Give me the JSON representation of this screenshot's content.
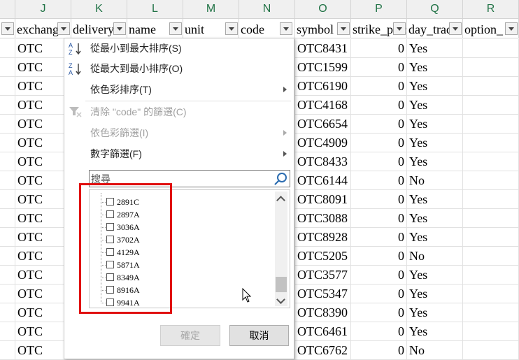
{
  "columns": [
    {
      "letter": "J",
      "header": "exchange"
    },
    {
      "letter": "K",
      "header": "delivery"
    },
    {
      "letter": "L",
      "header": "name"
    },
    {
      "letter": "M",
      "header": "unit"
    },
    {
      "letter": "N",
      "header": "code"
    },
    {
      "letter": "O",
      "header": "symbol"
    },
    {
      "letter": "P",
      "header": "strike_price"
    },
    {
      "letter": "Q",
      "header": "day_trade"
    },
    {
      "letter": "R",
      "header": "option_"
    }
  ],
  "rows": [
    {
      "exchange": "OTC",
      "symbol": "OTC8431",
      "strike": "0",
      "day_trade": "Yes"
    },
    {
      "exchange": "OTC",
      "symbol": "OTC1599",
      "strike": "0",
      "day_trade": "Yes"
    },
    {
      "exchange": "OTC",
      "symbol": "OTC6190",
      "strike": "0",
      "day_trade": "Yes"
    },
    {
      "exchange": "OTC",
      "symbol": "OTC4168",
      "strike": "0",
      "day_trade": "Yes"
    },
    {
      "exchange": "OTC",
      "symbol": "OTC6654",
      "strike": "0",
      "day_trade": "Yes"
    },
    {
      "exchange": "OTC",
      "symbol": "OTC4909",
      "strike": "0",
      "day_trade": "Yes"
    },
    {
      "exchange": "OTC",
      "symbol": "OTC8433",
      "strike": "0",
      "day_trade": "Yes"
    },
    {
      "exchange": "OTC",
      "symbol": "OTC6144",
      "strike": "0",
      "day_trade": "No"
    },
    {
      "exchange": "OTC",
      "symbol": "OTC8091",
      "strike": "0",
      "day_trade": "Yes"
    },
    {
      "exchange": "OTC",
      "symbol": "OTC3088",
      "strike": "0",
      "day_trade": "Yes"
    },
    {
      "exchange": "OTC",
      "symbol": "OTC8928",
      "strike": "0",
      "day_trade": "Yes"
    },
    {
      "exchange": "OTC",
      "symbol": "OTC5205",
      "strike": "0",
      "day_trade": "No"
    },
    {
      "exchange": "OTC",
      "symbol": "OTC3577",
      "strike": "0",
      "day_trade": "Yes"
    },
    {
      "exchange": "OTC",
      "symbol": "OTC5347",
      "strike": "0",
      "day_trade": "Yes"
    },
    {
      "exchange": "OTC",
      "symbol": "OTC8390",
      "strike": "0",
      "day_trade": "Yes"
    },
    {
      "exchange": "OTC",
      "symbol": "OTC6461",
      "strike": "0",
      "day_trade": "Yes"
    },
    {
      "exchange": "OTC",
      "symbol": "OTC6762",
      "strike": "0",
      "day_trade": "No"
    }
  ],
  "menu": {
    "sort_asc": "從最小到最大排序(S)",
    "sort_desc": "從最大到最小排序(O)",
    "sort_color": "依色彩排序(T)",
    "clear_filter": "清除 \"code\" 的篩選(C)",
    "filter_color": "依色彩篩選(I)",
    "number_filters": "數字篩選(F)",
    "search_placeholder": "搜尋",
    "list_items": [
      "2891C",
      "2897A",
      "3036A",
      "3702A",
      "4129A",
      "5871A",
      "8349A",
      "8916A",
      "9941A"
    ],
    "ok_label": "確定",
    "cancel_label": "取消"
  },
  "colors": {
    "header_letter": "#217346",
    "highlight_box": "#e01010"
  }
}
